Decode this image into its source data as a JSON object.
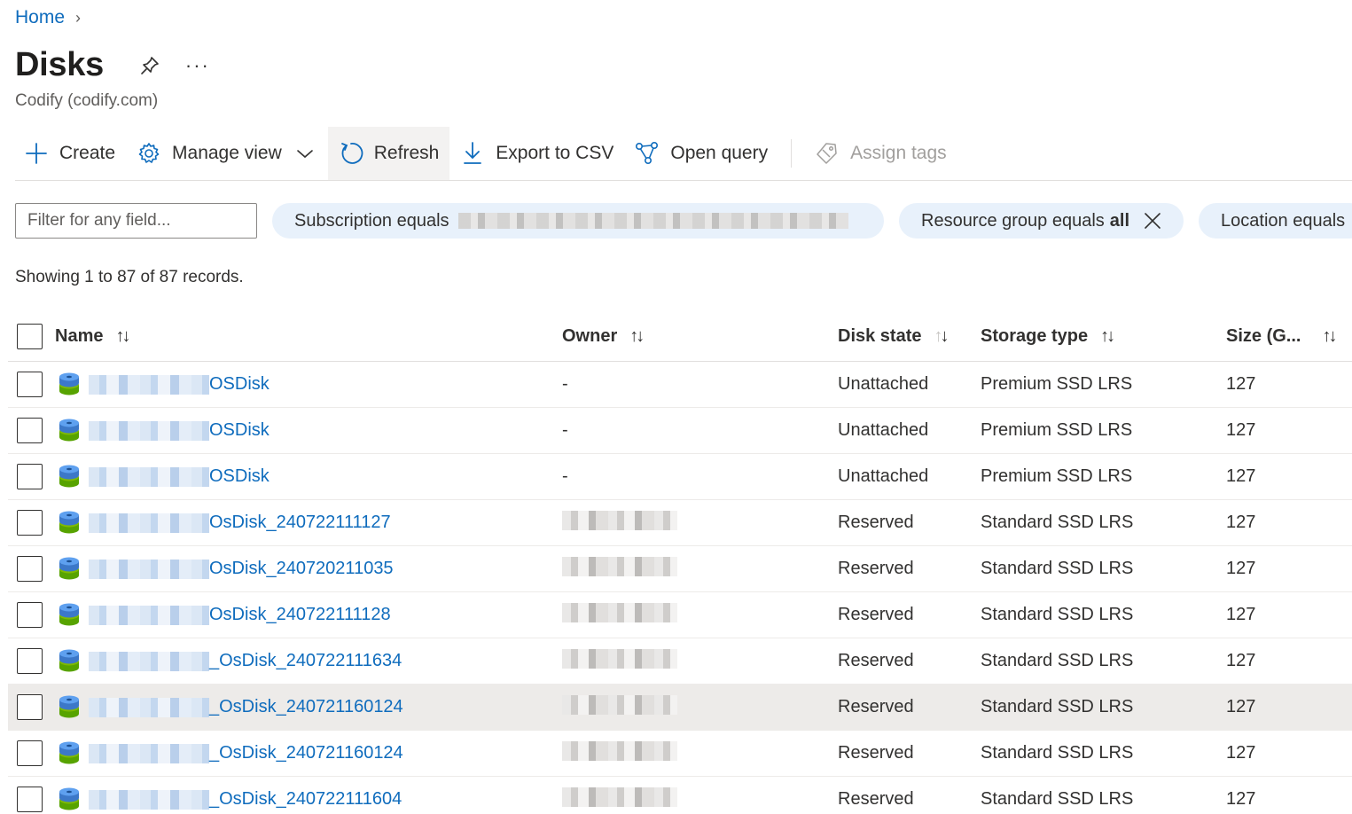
{
  "breadcrumb": {
    "home": "Home",
    "chevron": "›"
  },
  "header": {
    "title": "Disks",
    "more": "···",
    "subtitle": "Codify (codify.com)"
  },
  "toolbar": {
    "create": "Create",
    "manage_view": "Manage view",
    "refresh": "Refresh",
    "export_csv": "Export to CSV",
    "open_query": "Open query",
    "assign_tags": "Assign tags"
  },
  "filters": {
    "placeholder": "Filter for any field...",
    "subscription_label": "Subscription equals",
    "resource_group_label": "Resource group equals",
    "resource_group_value": "all",
    "location_label": "Location equals"
  },
  "records_text": "Showing 1 to 87 of 87 records.",
  "columns": {
    "name": "Name",
    "owner": "Owner",
    "disk_state": "Disk state",
    "storage_type": "Storage type",
    "size": "Size (G..."
  },
  "rows": [
    {
      "name": "OSDisk",
      "owner": "-",
      "state": "Unattached",
      "type": "Premium SSD LRS",
      "size": "127"
    },
    {
      "name": "OSDisk",
      "owner": "-",
      "state": "Unattached",
      "type": "Premium SSD LRS",
      "size": "127"
    },
    {
      "name": "OSDisk",
      "owner": "-",
      "state": "Unattached",
      "type": "Premium SSD LRS",
      "size": "127"
    },
    {
      "name": "OsDisk_240722111127",
      "owner": "",
      "state": "Reserved",
      "type": "Standard SSD LRS",
      "size": "127"
    },
    {
      "name": "OsDisk_240720211035",
      "owner": "",
      "state": "Reserved",
      "type": "Standard SSD LRS",
      "size": "127"
    },
    {
      "name": "OsDisk_240722111128",
      "owner": "",
      "state": "Reserved",
      "type": "Standard SSD LRS",
      "size": "127"
    },
    {
      "name": "_OsDisk_240722111634",
      "owner": "",
      "state": "Reserved",
      "type": "Standard SSD LRS",
      "size": "127"
    },
    {
      "name": "_OsDisk_240721160124",
      "owner": "",
      "state": "Reserved",
      "type": "Standard SSD LRS",
      "size": "127"
    },
    {
      "name": "_OsDisk_240721160124",
      "owner": "",
      "state": "Reserved",
      "type": "Standard SSD LRS",
      "size": "127"
    },
    {
      "name": "_OsDisk_240722111604",
      "owner": "",
      "state": "Reserved",
      "type": "Standard SSD LRS",
      "size": "127"
    }
  ],
  "colors": {
    "link": "#0f6cbd",
    "pill_bg": "#e8f1fb",
    "highlight_row": "#edebe9"
  },
  "icons": [
    "pin-icon",
    "more-icon",
    "plus-icon",
    "gear-icon",
    "chevron-down-icon",
    "refresh-icon",
    "download-icon",
    "query-icon",
    "tag-icon",
    "close-icon",
    "sort-icon",
    "disk-icon"
  ]
}
